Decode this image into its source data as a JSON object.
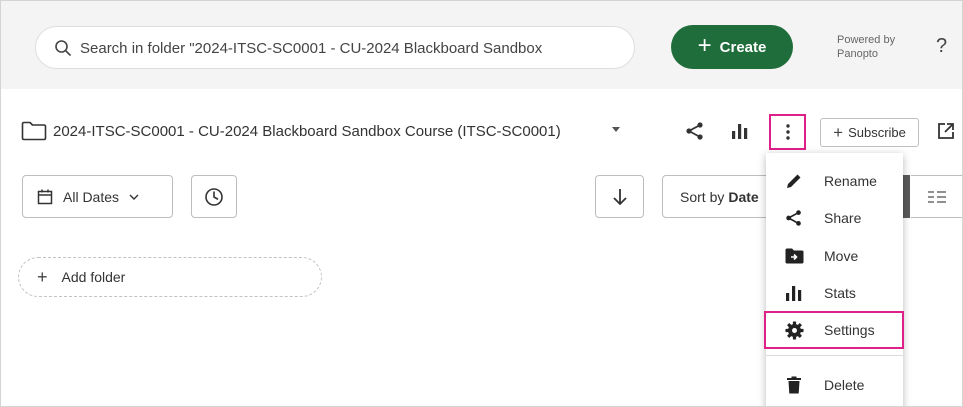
{
  "search": {
    "placeholder": "Search in folder \"2024-ITSC-SC0001 - CU-2024 Blackboard Sandbox"
  },
  "header": {
    "create_label": "Create",
    "powered_line1": "Powered by",
    "powered_line2": "Panopto",
    "help_label": "?"
  },
  "folder": {
    "title": "2024-ITSC-SC0001 - CU-2024 Blackboard Sandbox Course (ITSC-SC0001)",
    "subscribe_label": "Subscribe"
  },
  "filters": {
    "dates_label": "All Dates",
    "sort_prefix": "Sort by",
    "sort_value": "Date"
  },
  "add_folder_label": "Add folder",
  "menu": {
    "items": [
      {
        "label": "Rename",
        "icon": "pencil-icon"
      },
      {
        "label": "Share",
        "icon": "share-icon"
      },
      {
        "label": "Move",
        "icon": "move-folder-icon"
      },
      {
        "label": "Stats",
        "icon": "stats-icon"
      },
      {
        "label": "Settings",
        "icon": "gear-icon",
        "highlighted": true
      },
      {
        "label": "Delete",
        "icon": "trash-icon"
      }
    ]
  },
  "colors": {
    "create_bg": "#1f6d3a",
    "highlight": "#e0208a",
    "topbar_bg": "#f4f4f4"
  }
}
